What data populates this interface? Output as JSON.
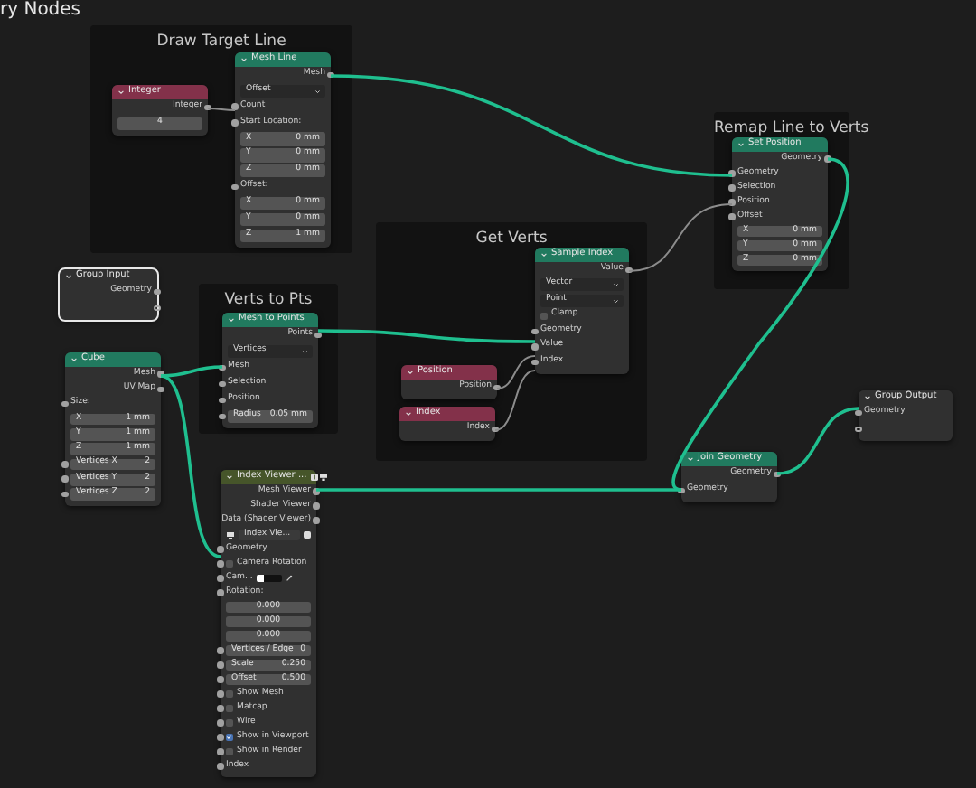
{
  "title": "ry Nodes",
  "frames": [
    {
      "label": "Draw Target Line"
    },
    {
      "label": "Remap Line to Verts"
    },
    {
      "label": "Get Verts"
    },
    {
      "label": "Verts to Pts"
    }
  ],
  "nodes": [
    {
      "title": "Integer",
      "color": "#83314a",
      "selected": false,
      "rows": [
        {
          "kind": "output",
          "label": "Integer"
        },
        {
          "kind": "field",
          "value": "4",
          "socket": false
        }
      ]
    },
    {
      "title": "Mesh Line",
      "color": "#217a5f",
      "selected": false,
      "rows": [
        {
          "kind": "output",
          "label": "Mesh"
        },
        {
          "kind": "dropdown",
          "value": "Offset",
          "socket": false
        },
        {
          "kind": "input",
          "label": "Count"
        },
        {
          "kind": "input",
          "label": "Start Location:"
        },
        {
          "kind": "field",
          "label": "X",
          "value": "0 mm",
          "socket": false
        },
        {
          "kind": "field",
          "label": "Y",
          "value": "0 mm",
          "socket": false
        },
        {
          "kind": "field",
          "label": "Z",
          "value": "0 mm",
          "socket": false
        },
        {
          "kind": "input",
          "label": "Offset:"
        },
        {
          "kind": "field",
          "label": "X",
          "value": "0 mm",
          "socket": false
        },
        {
          "kind": "field",
          "label": "Y",
          "value": "0 mm",
          "socket": false
        },
        {
          "kind": "field",
          "label": "Z",
          "value": "1 mm",
          "socket": false
        }
      ]
    },
    {
      "title": "Set Position",
      "color": "#217a5f",
      "selected": false,
      "rows": [
        {
          "kind": "output",
          "label": "Geometry"
        },
        {
          "kind": "input",
          "label": "Geometry"
        },
        {
          "kind": "input",
          "label": "Selection"
        },
        {
          "kind": "input",
          "label": "Position"
        },
        {
          "kind": "input",
          "label": "Offset"
        },
        {
          "kind": "field",
          "label": "X",
          "value": "0 mm",
          "socket": false
        },
        {
          "kind": "field",
          "label": "Y",
          "value": "0 mm",
          "socket": false
        },
        {
          "kind": "field",
          "label": "Z",
          "value": "0 mm",
          "socket": false
        }
      ]
    },
    {
      "title": "Sample Index",
      "color": "#217a5f",
      "selected": false,
      "rows": [
        {
          "kind": "output",
          "label": "Value"
        },
        {
          "kind": "dropdown",
          "value": "Vector",
          "socket": false
        },
        {
          "kind": "dropdown",
          "value": "Point",
          "socket": false
        },
        {
          "kind": "checkbox",
          "label": "Clamp",
          "checked": false,
          "socket": false
        },
        {
          "kind": "input",
          "label": "Geometry"
        },
        {
          "kind": "input",
          "label": "Value"
        },
        {
          "kind": "input",
          "label": "Index"
        }
      ]
    },
    {
      "title": "Position",
      "color": "#83314a",
      "selected": false,
      "rows": [
        {
          "kind": "output",
          "label": "Position"
        }
      ]
    },
    {
      "title": "Index",
      "color": "#83314a",
      "selected": false,
      "rows": [
        {
          "kind": "output",
          "label": "Index"
        }
      ]
    },
    {
      "title": "Group Input",
      "color": "#303030",
      "selected": true,
      "rows": [
        {
          "kind": "output",
          "label": "Geometry"
        },
        {
          "kind": "spare-out"
        }
      ]
    },
    {
      "title": "Mesh to Points",
      "color": "#217a5f",
      "selected": false,
      "rows": [
        {
          "kind": "output",
          "label": "Points"
        },
        {
          "kind": "dropdown",
          "value": "Vertices",
          "socket": false
        },
        {
          "kind": "input",
          "label": "Mesh"
        },
        {
          "kind": "input",
          "label": "Selection"
        },
        {
          "kind": "input",
          "label": "Position"
        },
        {
          "kind": "field",
          "label": "Radius",
          "value": "0.05 mm",
          "socket": true
        }
      ]
    },
    {
      "title": "Cube",
      "color": "#217a5f",
      "selected": false,
      "rows": [
        {
          "kind": "output",
          "label": "Mesh"
        },
        {
          "kind": "output",
          "label": "UV Map"
        },
        {
          "kind": "input",
          "label": "Size:"
        },
        {
          "kind": "field",
          "label": "X",
          "value": "1 mm",
          "socket": false
        },
        {
          "kind": "field",
          "label": "Y",
          "value": "1 mm",
          "socket": false
        },
        {
          "kind": "field",
          "label": "Z",
          "value": "1 mm",
          "socket": false
        },
        {
          "kind": "field",
          "label": "Vertices X",
          "value": "2",
          "socket": true
        },
        {
          "kind": "field",
          "label": "Vertices Y",
          "value": "2",
          "socket": true
        },
        {
          "kind": "field",
          "label": "Vertices Z",
          "value": "2",
          "socket": true
        }
      ]
    },
    {
      "title": "Join Geometry",
      "color": "#217a5f",
      "selected": false,
      "rows": [
        {
          "kind": "output",
          "label": "Geometry"
        },
        {
          "kind": "input",
          "label": "Geometry"
        }
      ]
    },
    {
      "title": "Group Output",
      "color": "#303030",
      "selected": false,
      "rows": [
        {
          "kind": "input",
          "label": "Geometry"
        },
        {
          "kind": "spare-in"
        }
      ]
    },
    {
      "title": "Index Viewer ...",
      "color": "#46552a",
      "selected": false,
      "rows": [
        {
          "kind": "output",
          "label": "Mesh Viewer"
        },
        {
          "kind": "output",
          "label": "Shader Viewer"
        },
        {
          "kind": "output",
          "label": "Data (Shader Viewer)"
        },
        {
          "kind": "viewer",
          "value": "Index Vie..."
        },
        {
          "kind": "input",
          "label": "Geometry"
        },
        {
          "kind": "checkbox",
          "label": "Camera Rotation",
          "checked": false,
          "socket": true
        },
        {
          "kind": "color",
          "label": "Cam...",
          "socket": true
        },
        {
          "kind": "input",
          "label": "Rotation:"
        },
        {
          "kind": "field",
          "value": "0.000",
          "socket": false
        },
        {
          "kind": "field",
          "value": "0.000",
          "socket": false
        },
        {
          "kind": "field",
          "value": "0.000",
          "socket": false
        },
        {
          "kind": "field",
          "label": "Vertices / Edge",
          "value": "0",
          "socket": true
        },
        {
          "kind": "field",
          "label": "Scale",
          "value": "0.250",
          "socket": true
        },
        {
          "kind": "field",
          "label": "Offset",
          "value": "0.500",
          "socket": true
        },
        {
          "kind": "checkbox",
          "label": "Show Mesh",
          "checked": false,
          "socket": true
        },
        {
          "kind": "checkbox",
          "label": "Matcap",
          "checked": false,
          "socket": true
        },
        {
          "kind": "checkbox",
          "label": "Wire",
          "checked": false,
          "socket": true
        },
        {
          "kind": "checkbox",
          "label": "Show in Viewport",
          "checked": true,
          "socket": true
        },
        {
          "kind": "checkbox",
          "label": "Show in Render",
          "checked": false,
          "socket": true
        },
        {
          "kind": "input",
          "label": "Index"
        }
      ]
    }
  ]
}
